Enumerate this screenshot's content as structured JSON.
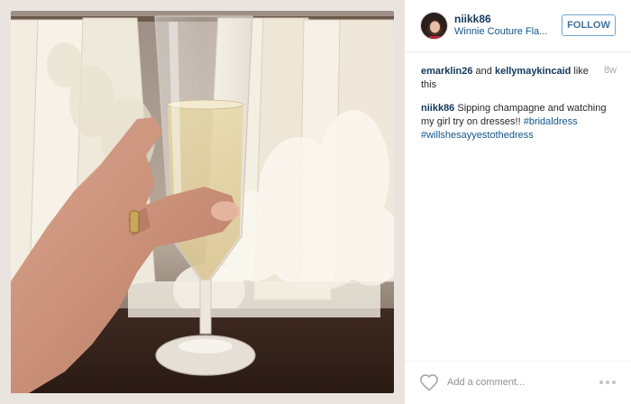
{
  "post": {
    "username": "niikk86",
    "location": "Winnie Couture Fla...",
    "follow_label": "FOLLOW",
    "photo_icon": "photo-champagne-flute",
    "likes": {
      "user1": "emarklin26",
      "joiner": " and ",
      "user2": "kellymaykincaid",
      "suffix": " like this"
    },
    "age": "8w",
    "caption": {
      "username": "niikk86",
      "text": " Sipping champagne and watching my girl try on dresses!! ",
      "tag1": "#bridaldress",
      "tag2": "#willshesayyestothedress"
    },
    "comment_placeholder": "Add a comment...",
    "icons": {
      "like": "heart-icon",
      "more": "more-options-icon"
    },
    "colors": {
      "link": "#125688",
      "username": "#12385b",
      "follow_border": "#6fa7d0",
      "follow_text": "#3f729b"
    }
  }
}
